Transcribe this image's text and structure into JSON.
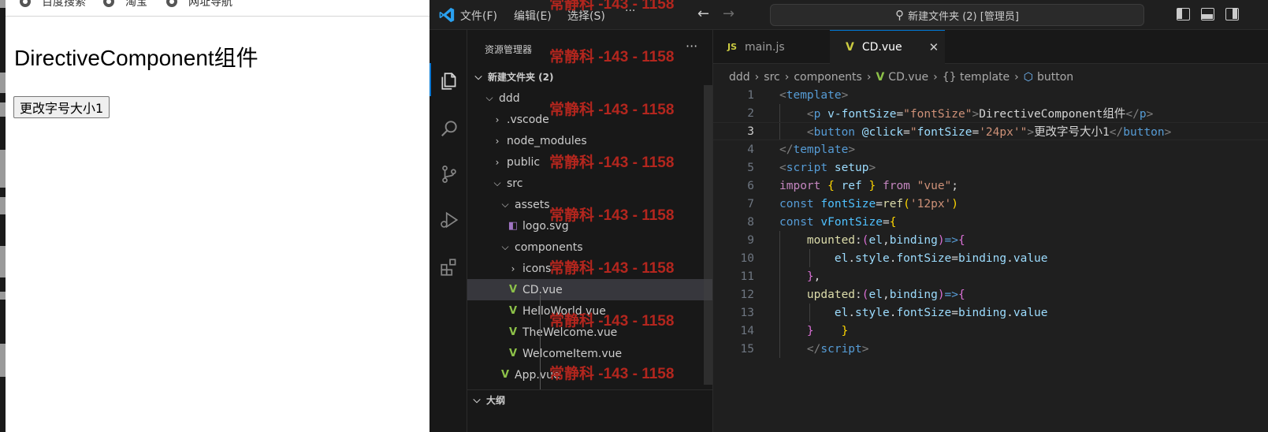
{
  "browser": {
    "bookmarks": [
      "百度搜索",
      "淘宝",
      "网址导航"
    ],
    "heading": "DirectiveComponent组件",
    "button_label": "更改字号大小1"
  },
  "vscode": {
    "menu": [
      "文件(F)",
      "编辑(E)",
      "选择(S)",
      "···"
    ],
    "command_center": "新建文件夹 (2) [管理员]",
    "activity_icons": [
      "explorer-icon",
      "search-icon",
      "source-control-icon",
      "run-debug-icon",
      "extensions-icon"
    ],
    "explorer": {
      "title": "资源管理器",
      "more": "···",
      "tree": [
        {
          "label": "新建文件夹 (2)",
          "type": "root",
          "expanded": true,
          "depth": 0
        },
        {
          "label": "ddd",
          "type": "folder",
          "expanded": true,
          "depth": 1
        },
        {
          "label": ".vscode",
          "type": "folder",
          "expanded": false,
          "depth": 2
        },
        {
          "label": "node_modules",
          "type": "folder",
          "expanded": false,
          "depth": 2
        },
        {
          "label": "public",
          "type": "folder",
          "expanded": false,
          "depth": 2
        },
        {
          "label": "src",
          "type": "folder",
          "expanded": true,
          "depth": 2
        },
        {
          "label": "assets",
          "type": "folder",
          "expanded": true,
          "depth": 3
        },
        {
          "label": "logo.svg",
          "type": "svg",
          "depth": 4
        },
        {
          "label": "components",
          "type": "folder",
          "expanded": true,
          "depth": 3
        },
        {
          "label": "icons",
          "type": "folder",
          "expanded": false,
          "depth": 4
        },
        {
          "label": "CD.vue",
          "type": "vue",
          "depth": 4,
          "selected": true
        },
        {
          "label": "HelloWorld.vue",
          "type": "vue",
          "depth": 4
        },
        {
          "label": "TheWelcome.vue",
          "type": "vue",
          "depth": 4
        },
        {
          "label": "WelcomeItem.vue",
          "type": "vue",
          "depth": 4
        },
        {
          "label": "App.vue",
          "type": "vue",
          "depth": 3
        }
      ],
      "outline_title": "大纲"
    },
    "tabs": [
      {
        "label": "main.js",
        "icon": "JS",
        "active": false
      },
      {
        "label": "CD.vue",
        "icon": "vue",
        "active": true
      }
    ],
    "tab_close": "✕",
    "breadcrumb": [
      "ddd",
      "src",
      "components",
      "CD.vue",
      "{} template",
      "button"
    ],
    "code": [
      [
        [
          "<",
          "#808080"
        ],
        [
          "template",
          "#569cd6"
        ],
        [
          ">",
          "#808080"
        ]
      ],
      [
        [
          "    ",
          "#d4d4d4"
        ],
        [
          "<",
          "#808080"
        ],
        [
          "p ",
          "#569cd6"
        ],
        [
          "v-fontSize",
          "#9cdcfe"
        ],
        [
          "=",
          "#d4d4d4"
        ],
        [
          "\"fontSize\"",
          "#ce9178"
        ],
        [
          ">",
          "#808080"
        ],
        [
          "DirectiveComponent组件",
          "#d4d4d4"
        ],
        [
          "</",
          "#808080"
        ],
        [
          "p",
          "#569cd6"
        ],
        [
          ">",
          "#808080"
        ]
      ],
      [
        [
          "    ",
          "#d4d4d4"
        ],
        [
          "<",
          "#808080"
        ],
        [
          "button ",
          "#569cd6"
        ],
        [
          "@click",
          "#9cdcfe"
        ],
        [
          "=",
          "#d4d4d4"
        ],
        [
          "\"",
          "#ce9178"
        ],
        [
          "fontSize",
          "#9cdcfe"
        ],
        [
          "=",
          "#d4d4d4"
        ],
        [
          "'24px'",
          "#ce9178"
        ],
        [
          "\"",
          "#ce9178"
        ],
        [
          ">",
          "#808080"
        ],
        [
          "更改字号大小1",
          "#d4d4d4"
        ],
        [
          "</",
          "#808080"
        ],
        [
          "button",
          "#569cd6"
        ],
        [
          ">",
          "#808080"
        ]
      ],
      [
        [
          "</",
          "#808080"
        ],
        [
          "template",
          "#569cd6"
        ],
        [
          ">",
          "#808080"
        ]
      ],
      [
        [
          "<",
          "#808080"
        ],
        [
          "script ",
          "#569cd6"
        ],
        [
          "setup",
          "#9cdcfe"
        ],
        [
          ">",
          "#808080"
        ]
      ],
      [
        [
          "import ",
          "#c586c0"
        ],
        [
          "{ ",
          "#ffd700"
        ],
        [
          "ref",
          "#9cdcfe"
        ],
        [
          " } ",
          "#ffd700"
        ],
        [
          "from ",
          "#c586c0"
        ],
        [
          "\"vue\"",
          "#ce9178"
        ],
        [
          ";",
          "#d4d4d4"
        ]
      ],
      [
        [
          "const ",
          "#569cd6"
        ],
        [
          "fontSize",
          "#4fc1ff"
        ],
        [
          "=",
          "#d4d4d4"
        ],
        [
          "ref",
          "#dcdcaa"
        ],
        [
          "(",
          "#ffd700"
        ],
        [
          "'12px'",
          "#ce9178"
        ],
        [
          ")",
          "#ffd700"
        ]
      ],
      [
        [
          "const ",
          "#569cd6"
        ],
        [
          "vFontSize",
          "#4fc1ff"
        ],
        [
          "=",
          "#d4d4d4"
        ],
        [
          "{",
          "#ffd700"
        ]
      ],
      [
        [
          "    ",
          "#d4d4d4"
        ],
        [
          "mounted",
          "#dcdcaa"
        ],
        [
          ":",
          "#d4d4d4"
        ],
        [
          "(",
          "#da70d6"
        ],
        [
          "el",
          "#9cdcfe"
        ],
        [
          ",",
          "#d4d4d4"
        ],
        [
          "binding",
          "#9cdcfe"
        ],
        [
          ")",
          "#da70d6"
        ],
        [
          "=>",
          "#569cd6"
        ],
        [
          "{",
          "#da70d6"
        ]
      ],
      [
        [
          "        ",
          "#d4d4d4"
        ],
        [
          "el",
          "#9cdcfe"
        ],
        [
          ".",
          "#d4d4d4"
        ],
        [
          "style",
          "#9cdcfe"
        ],
        [
          ".",
          "#d4d4d4"
        ],
        [
          "fontSize",
          "#9cdcfe"
        ],
        [
          "=",
          "#d4d4d4"
        ],
        [
          "binding",
          "#9cdcfe"
        ],
        [
          ".",
          "#d4d4d4"
        ],
        [
          "value",
          "#9cdcfe"
        ]
      ],
      [
        [
          "    ",
          "#d4d4d4"
        ],
        [
          "}",
          "#da70d6"
        ],
        [
          ",",
          "#d4d4d4"
        ]
      ],
      [
        [
          "    ",
          "#d4d4d4"
        ],
        [
          "updated",
          "#dcdcaa"
        ],
        [
          ":",
          "#d4d4d4"
        ],
        [
          "(",
          "#da70d6"
        ],
        [
          "el",
          "#9cdcfe"
        ],
        [
          ",",
          "#d4d4d4"
        ],
        [
          "binding",
          "#9cdcfe"
        ],
        [
          ")",
          "#da70d6"
        ],
        [
          "=>",
          "#569cd6"
        ],
        [
          "{",
          "#da70d6"
        ]
      ],
      [
        [
          "        ",
          "#d4d4d4"
        ],
        [
          "el",
          "#9cdcfe"
        ],
        [
          ".",
          "#d4d4d4"
        ],
        [
          "style",
          "#9cdcfe"
        ],
        [
          ".",
          "#d4d4d4"
        ],
        [
          "fontSize",
          "#9cdcfe"
        ],
        [
          "=",
          "#d4d4d4"
        ],
        [
          "binding",
          "#9cdcfe"
        ],
        [
          ".",
          "#d4d4d4"
        ],
        [
          "value",
          "#9cdcfe"
        ]
      ],
      [
        [
          "    ",
          "#d4d4d4"
        ],
        [
          "}",
          "#da70d6"
        ],
        [
          "    ",
          "#d4d4d4"
        ],
        [
          "}",
          "#ffd700"
        ]
      ],
      [
        [
          "    ",
          "#d4d4d4"
        ],
        [
          "</",
          "#808080"
        ],
        [
          "script",
          "#569cd6"
        ],
        [
          ">",
          "#808080"
        ]
      ]
    ],
    "current_line": 3,
    "accent": "#0078d4"
  },
  "watermark": "常静科 -143 - 1158"
}
